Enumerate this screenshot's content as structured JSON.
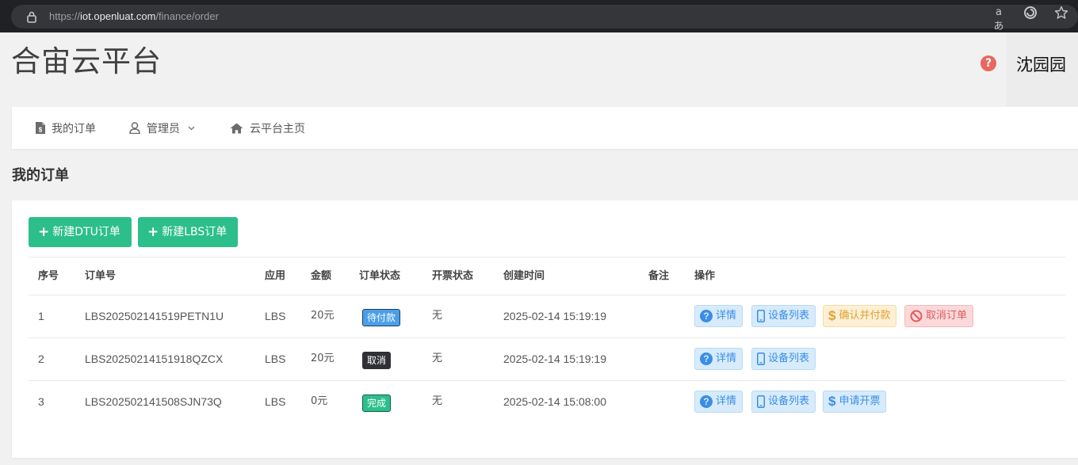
{
  "browser": {
    "url_prefix": "https://",
    "url_host": "iot.openluat.com",
    "url_path": "/finance/order"
  },
  "header": {
    "brand": "合宙云平台",
    "user_name": "沈园园"
  },
  "nav": {
    "items": [
      {
        "label": "我的订单",
        "icon": "file-dollar-icon"
      },
      {
        "label": "管理员",
        "icon": "user-icon"
      },
      {
        "label": "云平台主页",
        "icon": "home-icon"
      }
    ]
  },
  "page": {
    "title": "我的订单"
  },
  "toolbar": {
    "new_dtu_label": "新建DTU订单",
    "new_lbs_label": "新建LBS订单"
  },
  "table": {
    "columns": [
      "序号",
      "订单号",
      "应用",
      "金额",
      "订单状态",
      "开票状态",
      "创建时间",
      "备注",
      "操作"
    ],
    "rows": [
      {
        "index": "1",
        "order_no": "LBS202502141519PETN1U",
        "app": "LBS",
        "amount": "20元",
        "status": "待付款",
        "invoice": "无",
        "created": "2025-02-14 15:19:19",
        "remark": "",
        "actions": {
          "detail": "详情",
          "devices": "设备列表",
          "confirm_pay": "确认并付款",
          "cancel": "取消订单"
        }
      },
      {
        "index": "2",
        "order_no": "LBS20250214151918QZCX",
        "app": "LBS",
        "amount": "20元",
        "status": "取消",
        "invoice": "无",
        "created": "2025-02-14 15:19:19",
        "remark": "",
        "actions": {
          "detail": "详情",
          "devices": "设备列表"
        }
      },
      {
        "index": "3",
        "order_no": "LBS202502141508SJN73Q",
        "app": "LBS",
        "amount": "0元",
        "status": "完成",
        "invoice": "无",
        "created": "2025-02-14 15:08:00",
        "remark": "",
        "actions": {
          "detail": "详情",
          "devices": "设备列表",
          "invoice_apply": "申请开票"
        }
      }
    ]
  },
  "colors": {
    "primary_green": "#2dbf8b",
    "info_blue": "#3a8ee6",
    "warning_orange": "#e0a23a",
    "danger_red": "#e05b5f"
  }
}
